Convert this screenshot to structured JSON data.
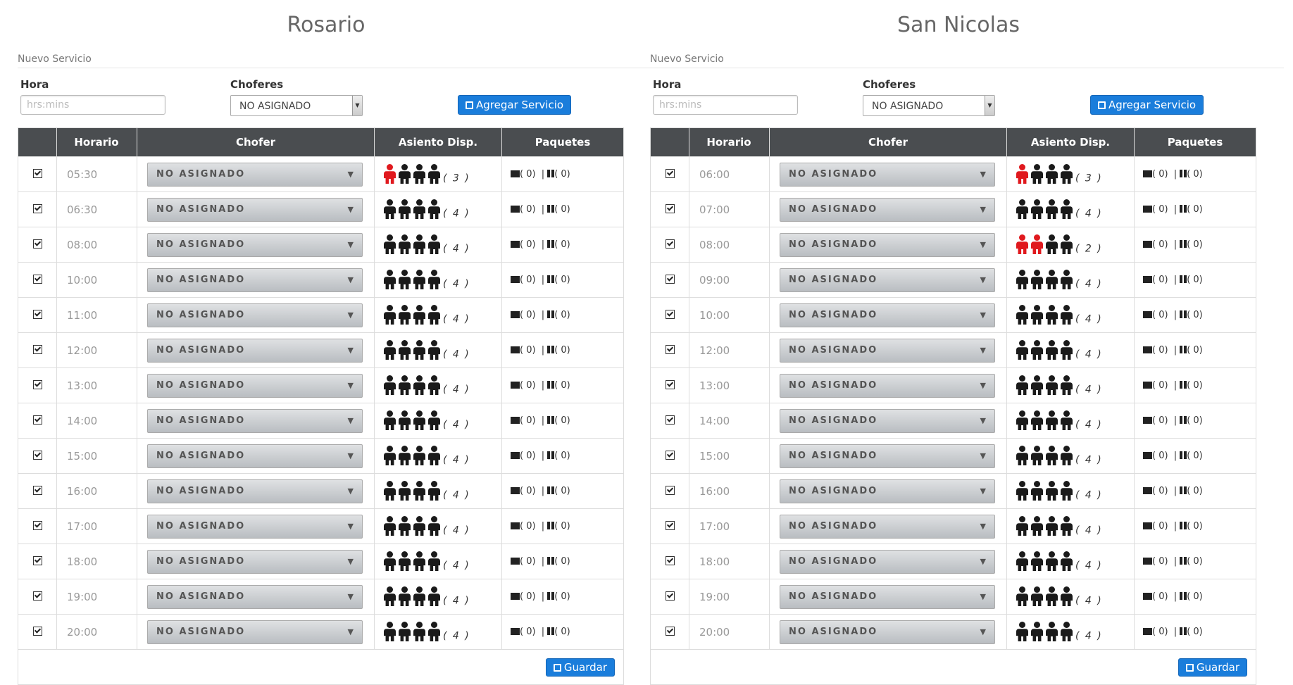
{
  "panels": [
    {
      "title": "Rosario",
      "nuevo_label": "Nuevo Servicio",
      "hora_label": "Hora",
      "hora_placeholder": "hrs:mins",
      "choferes_label": "Choferes",
      "choferes_value": "NO ASIGNADO",
      "agregar_label": "Agregar Servicio",
      "headers": [
        "Horario",
        "Chofer",
        "Asiento Disp.",
        "Paquetes"
      ],
      "guardar_label": "Guardar",
      "rows": [
        {
          "time": "05:30",
          "chofer": "NO ASIGNADO",
          "taken": 1,
          "count": "( 3 )",
          "mail": "( 0)",
          "pkg": "( 0)"
        },
        {
          "time": "06:30",
          "chofer": "NO ASIGNADO",
          "taken": 0,
          "count": "( 4 )",
          "mail": "( 0)",
          "pkg": "( 0)"
        },
        {
          "time": "08:00",
          "chofer": "NO ASIGNADO",
          "taken": 0,
          "count": "( 4 )",
          "mail": "( 0)",
          "pkg": "( 0)"
        },
        {
          "time": "10:00",
          "chofer": "NO ASIGNADO",
          "taken": 0,
          "count": "( 4 )",
          "mail": "( 0)",
          "pkg": "( 0)"
        },
        {
          "time": "11:00",
          "chofer": "NO ASIGNADO",
          "taken": 0,
          "count": "( 4 )",
          "mail": "( 0)",
          "pkg": "( 0)"
        },
        {
          "time": "12:00",
          "chofer": "NO ASIGNADO",
          "taken": 0,
          "count": "( 4 )",
          "mail": "( 0)",
          "pkg": "( 0)"
        },
        {
          "time": "13:00",
          "chofer": "NO ASIGNADO",
          "taken": 0,
          "count": "( 4 )",
          "mail": "( 0)",
          "pkg": "( 0)"
        },
        {
          "time": "14:00",
          "chofer": "NO ASIGNADO",
          "taken": 0,
          "count": "( 4 )",
          "mail": "( 0)",
          "pkg": "( 0)"
        },
        {
          "time": "15:00",
          "chofer": "NO ASIGNADO",
          "taken": 0,
          "count": "( 4 )",
          "mail": "( 0)",
          "pkg": "( 0)"
        },
        {
          "time": "16:00",
          "chofer": "NO ASIGNADO",
          "taken": 0,
          "count": "( 4 )",
          "mail": "( 0)",
          "pkg": "( 0)"
        },
        {
          "time": "17:00",
          "chofer": "NO ASIGNADO",
          "taken": 0,
          "count": "( 4 )",
          "mail": "( 0)",
          "pkg": "( 0)"
        },
        {
          "time": "18:00",
          "chofer": "NO ASIGNADO",
          "taken": 0,
          "count": "( 4 )",
          "mail": "( 0)",
          "pkg": "( 0)"
        },
        {
          "time": "19:00",
          "chofer": "NO ASIGNADO",
          "taken": 0,
          "count": "( 4 )",
          "mail": "( 0)",
          "pkg": "( 0)"
        },
        {
          "time": "20:00",
          "chofer": "NO ASIGNADO",
          "taken": 0,
          "count": "( 4 )",
          "mail": "( 0)",
          "pkg": "( 0)"
        }
      ]
    },
    {
      "title": "San Nicolas",
      "nuevo_label": "Nuevo Servicio",
      "hora_label": "Hora",
      "hora_placeholder": "hrs:mins",
      "choferes_label": "Choferes",
      "choferes_value": "NO ASIGNADO",
      "agregar_label": "Agregar Servicio",
      "headers": [
        "Horario",
        "Chofer",
        "Asiento Disp.",
        "Paquetes"
      ],
      "guardar_label": "Guardar",
      "rows": [
        {
          "time": "06:00",
          "chofer": "NO ASIGNADO",
          "taken": 1,
          "count": "( 3 )",
          "mail": "( 0)",
          "pkg": "( 0)"
        },
        {
          "time": "07:00",
          "chofer": "NO ASIGNADO",
          "taken": 0,
          "count": "( 4 )",
          "mail": "( 0)",
          "pkg": "( 0)"
        },
        {
          "time": "08:00",
          "chofer": "NO ASIGNADO",
          "taken": 2,
          "count": "( 2 )",
          "mail": "( 0)",
          "pkg": "( 0)"
        },
        {
          "time": "09:00",
          "chofer": "NO ASIGNADO",
          "taken": 0,
          "count": "( 4 )",
          "mail": "( 0)",
          "pkg": "( 0)"
        },
        {
          "time": "10:00",
          "chofer": "NO ASIGNADO",
          "taken": 0,
          "count": "( 4 )",
          "mail": "( 0)",
          "pkg": "( 0)"
        },
        {
          "time": "12:00",
          "chofer": "NO ASIGNADO",
          "taken": 0,
          "count": "( 4 )",
          "mail": "( 0)",
          "pkg": "( 0)"
        },
        {
          "time": "13:00",
          "chofer": "NO ASIGNADO",
          "taken": 0,
          "count": "( 4 )",
          "mail": "( 0)",
          "pkg": "( 0)"
        },
        {
          "time": "14:00",
          "chofer": "NO ASIGNADO",
          "taken": 0,
          "count": "( 4 )",
          "mail": "( 0)",
          "pkg": "( 0)"
        },
        {
          "time": "15:00",
          "chofer": "NO ASIGNADO",
          "taken": 0,
          "count": "( 4 )",
          "mail": "( 0)",
          "pkg": "( 0)"
        },
        {
          "time": "16:00",
          "chofer": "NO ASIGNADO",
          "taken": 0,
          "count": "( 4 )",
          "mail": "( 0)",
          "pkg": "( 0)"
        },
        {
          "time": "17:00",
          "chofer": "NO ASIGNADO",
          "taken": 0,
          "count": "( 4 )",
          "mail": "( 0)",
          "pkg": "( 0)"
        },
        {
          "time": "18:00",
          "chofer": "NO ASIGNADO",
          "taken": 0,
          "count": "( 4 )",
          "mail": "( 0)",
          "pkg": "( 0)"
        },
        {
          "time": "19:00",
          "chofer": "NO ASIGNADO",
          "taken": 0,
          "count": "( 4 )",
          "mail": "( 0)",
          "pkg": "( 0)"
        },
        {
          "time": "20:00",
          "chofer": "NO ASIGNADO",
          "taken": 0,
          "count": "( 4 )",
          "mail": "( 0)",
          "pkg": "( 0)"
        }
      ]
    }
  ],
  "seats_total": 4,
  "colors": {
    "accent": "#1a7ddb",
    "header_bg": "#4a4d50",
    "seat_taken": "#e0191e",
    "seat_free": "#1a1a1a"
  },
  "icons": {
    "check": "checkbox-checked-icon",
    "seat": "person-icon",
    "mail": "envelope-icon",
    "package": "gift-icon",
    "save": "floppy-disk-icon"
  }
}
